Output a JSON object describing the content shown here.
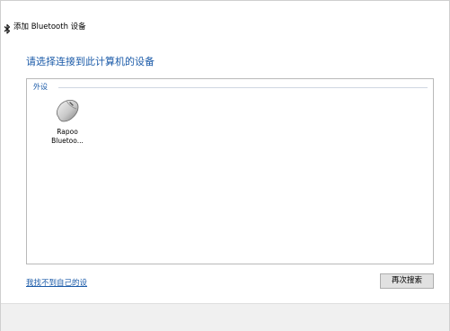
{
  "window": {
    "title": "添加 Bluetooth 设备",
    "title_icon": "bluetooth-icon"
  },
  "main": {
    "heading": "请选择连接到此计算机的设备",
    "group_label": "外设",
    "devices": [
      {
        "name_line1": "Rapoo",
        "name_line2": "Bluetoo...",
        "icon": "mouse-icon"
      }
    ]
  },
  "bottom": {
    "link_label": "我找不到自己的设",
    "search_again_label": "再次搜索"
  },
  "colors": {
    "accent_text": "#1a5aa8",
    "footer_bg": "#f0f0f0",
    "button_bg": "#e1e1e1"
  }
}
